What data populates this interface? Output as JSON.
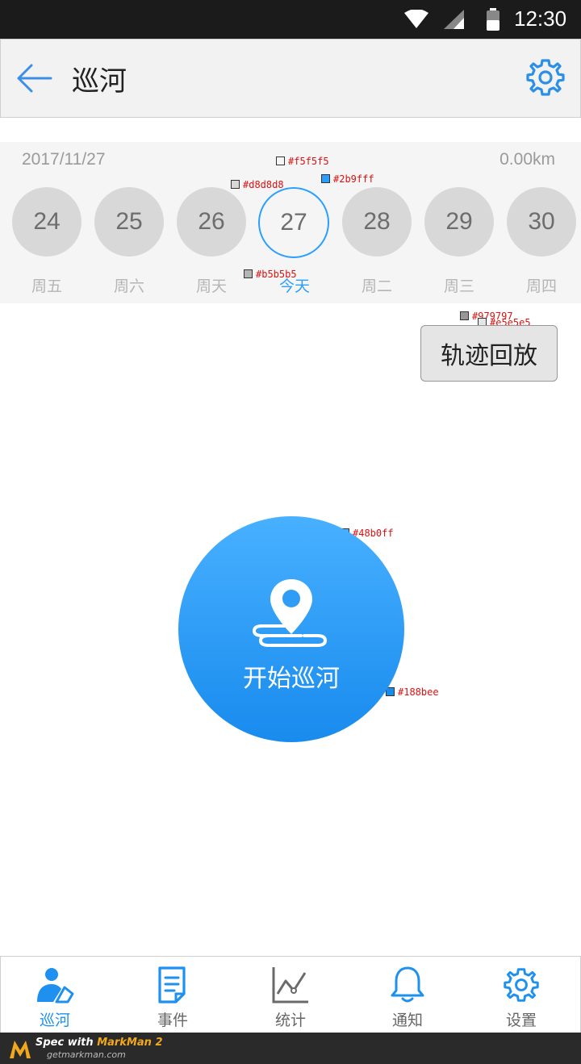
{
  "status_bar": {
    "time": "12:30"
  },
  "header": {
    "title": "巡河"
  },
  "date_strip": {
    "date": "2017/11/27",
    "distance": "0.00km",
    "days": [
      {
        "day": "24",
        "weekday": "周五"
      },
      {
        "day": "25",
        "weekday": "周六"
      },
      {
        "day": "26",
        "weekday": "周天"
      },
      {
        "day": "27",
        "weekday": "今天",
        "today": true
      },
      {
        "day": "28",
        "weekday": "周二"
      },
      {
        "day": "29",
        "weekday": "周三"
      },
      {
        "day": "30",
        "weekday": "周四"
      }
    ]
  },
  "playback_button": {
    "label": "轨迹回放"
  },
  "start_button": {
    "label": "开始巡河"
  },
  "annotations": {
    "strip_bg": "#f5f5f5",
    "day_bg": "#d8d8d8",
    "today_border": "#2b9fff",
    "weekday_text": "#b5b5b5",
    "playback_border": "#979797",
    "playback_bg": "#e5e5e5",
    "gradient_top": "#48b0ff",
    "gradient_bottom": "#188bee"
  },
  "bottom_nav": {
    "items": [
      {
        "label": "巡河",
        "icon": "patrol-icon",
        "active": true
      },
      {
        "label": "事件",
        "icon": "document-icon"
      },
      {
        "label": "统计",
        "icon": "chart-icon"
      },
      {
        "label": "通知",
        "icon": "bell-icon"
      },
      {
        "label": "设置",
        "icon": "gear-icon"
      }
    ]
  },
  "footer": {
    "line1_prefix": "Spec with ",
    "line1_brand": "MarkMan 2",
    "line2": "getmarkman.com"
  },
  "colors": {
    "accent": "#2b9fff",
    "nav_active": "#1e90ef",
    "nav_inactive": "#666666"
  }
}
